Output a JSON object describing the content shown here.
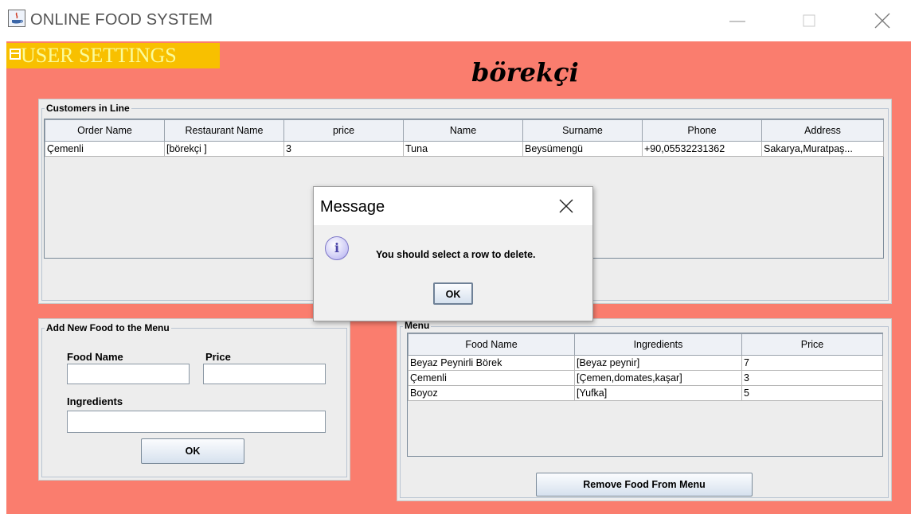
{
  "window": {
    "title": "ONLINE FOOD SYSTEM"
  },
  "menubar": {
    "user_settings": "USER SETTINGS"
  },
  "shop_title": "börekçi",
  "customers": {
    "legend": "Customers in Line",
    "columns": [
      "Order Name",
      "Restaurant Name",
      "price",
      "Name",
      "Surname",
      "Phone",
      "Address"
    ],
    "rows": [
      [
        "Çemenli",
        "[börekçi ]",
        "3",
        "Tuna",
        "Beysümengü",
        "+90,05532231362",
        "Sakarya,Muratpaş..."
      ]
    ]
  },
  "add_food": {
    "legend": "Add New Food to the Menu",
    "food_name_label": "Food Name",
    "price_label": "Price",
    "ingredients_label": "Ingredients",
    "food_name_value": "",
    "price_value": "",
    "ingredients_value": "",
    "ok_label": "OK"
  },
  "menu": {
    "legend": "Menu",
    "columns": [
      "Food Name",
      "Ingredients",
      "Price"
    ],
    "rows": [
      [
        "Beyaz Peynirli Börek",
        "[Beyaz peynir]",
        "7"
      ],
      [
        "Çemenli",
        "[Çemen,domates,kaşar]",
        "3"
      ],
      [
        "Boyoz",
        "[Yufka]",
        "5"
      ]
    ],
    "remove_label": "Remove Food From Menu"
  },
  "dialog": {
    "title": "Message",
    "message": "You should select a row to delete.",
    "ok_label": "OK",
    "icon": "info-icon"
  },
  "colors": {
    "background": "#fa7d6e",
    "menu_highlight": "#f8c000",
    "panel": "#ededed"
  }
}
